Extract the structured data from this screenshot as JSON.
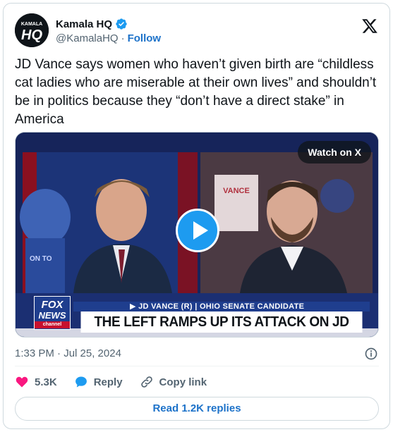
{
  "author": {
    "name": "Kamala HQ",
    "handle": "@KamalaHQ",
    "separator": "·",
    "follow_label": "Follow",
    "avatar_text_top": "KAMALA",
    "avatar_text_main": "HQ"
  },
  "tweet": {
    "text": "JD Vance says women who haven’t given birth are “childless cat ladies who are miserable at their own lives” and shouldn’t be in politics because they “don’t have a direct stake” in America",
    "timestamp": "1:33 PM · Jul 25, 2024"
  },
  "media": {
    "watch_label": "Watch on X",
    "chyron_top": "▶ JD VANCE (R) | OHIO SENATE CANDIDATE",
    "chyron_main": "THE LEFT RAMPS UP ITS ATTACK ON JD VANCE",
    "network_line1": "FOX",
    "network_line2": "NEWS",
    "network_line3": "channel",
    "sign_text": "VANCE",
    "podium_text": "ON TO"
  },
  "actions": {
    "likes_count": "5.3K",
    "reply_label": "Reply",
    "copy_label": "Copy link"
  },
  "footer": {
    "read_replies_label": "Read 1.2K replies"
  },
  "colors": {
    "accent": "#1d9bf0",
    "link": "#1d72c9",
    "like": "#f91880",
    "text": "#0f1419",
    "muted": "#536471",
    "border": "#cfd9de"
  }
}
